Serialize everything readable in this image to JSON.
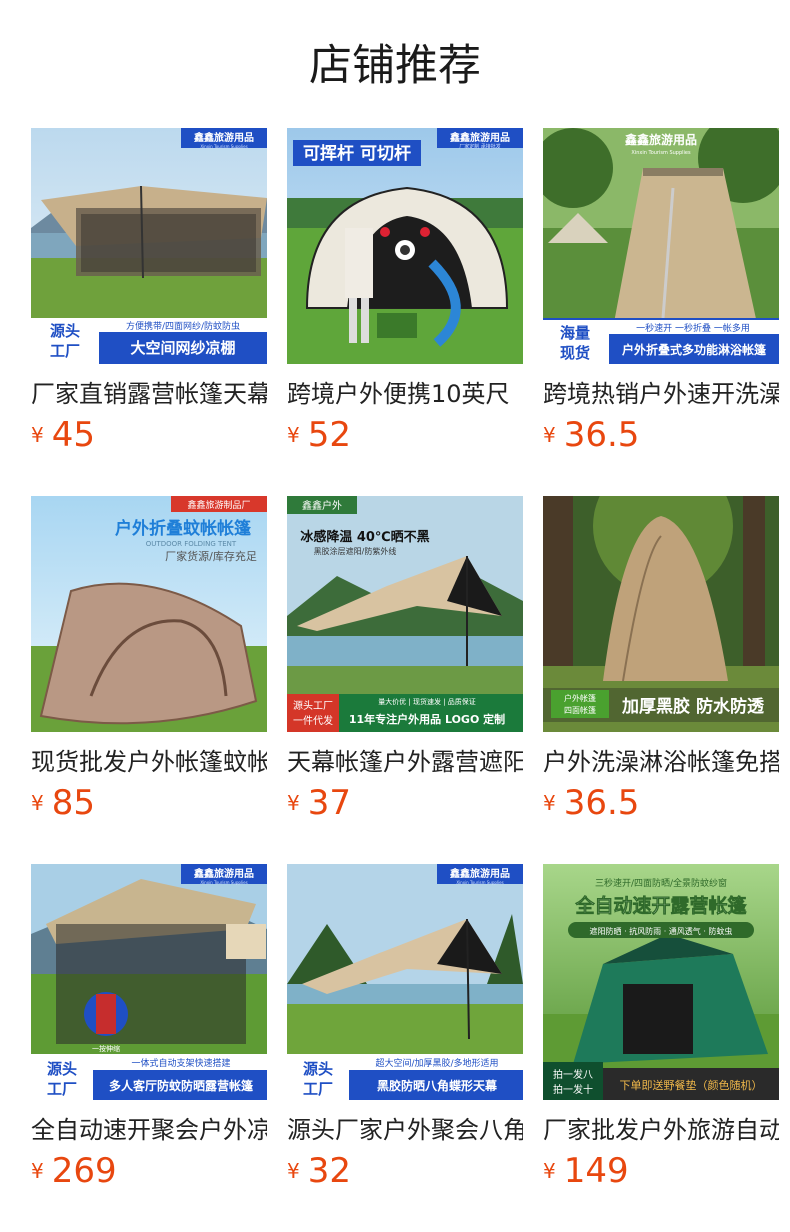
{
  "page": {
    "title": "店铺推荐"
  },
  "products": [
    {
      "name": "厂家直销露营帐篷天幕",
      "currency": "¥",
      "price": "45",
      "overlay": {
        "brand": "鑫鑫旅游用品",
        "brand_en": "Xinxin Tourism Supplies",
        "badge": "源头\n工厂",
        "tagline": "方便携带/四面网纱/防蚊防虫",
        "banner": "大空间网纱凉棚"
      }
    },
    {
      "name": "跨境户外便携10英尺",
      "currency": "¥",
      "price": "52",
      "overlay": {
        "headline": "可挥杆 可切杆",
        "brand": "鑫鑫旅游用品",
        "brand_en": "厂家定制 承接批发"
      }
    },
    {
      "name": "跨境热销户外速开洗澡帐篷",
      "currency": "¥",
      "price": "36.5",
      "overlay": {
        "brand": "鑫鑫旅游用品",
        "brand_en": "Xinxin Tourism Supplies",
        "badge": "海量\n现货",
        "tagline": "一秒速开 一秒折叠 一帐多用",
        "banner": "户外折叠式多功能淋浴帐篷"
      }
    },
    {
      "name": "现货批发户外帐篷蚊帐",
      "currency": "¥",
      "price": "85",
      "overlay": {
        "brand": "鑫鑫旅游制品厂",
        "headline": "户外折叠蚊帐帐篷",
        "sub_en": "OUTDOOR FOLDING TENT",
        "sub": "厂家货源/库存充足"
      }
    },
    {
      "name": "天幕帐篷户外露营遮阳",
      "currency": "¥",
      "price": "37",
      "overlay": {
        "brand": "鑫鑫户外",
        "headline": "冰感降温 40℃晒不黑",
        "sub": "黑胶涂层遮阳/防紫外线",
        "badge": "源头工厂\n一件代发",
        "tagline": "量大价优 | 现货速发 | 品质保证",
        "banner": "11年专注户外用品 LOGO 定制"
      }
    },
    {
      "name": "户外洗澡淋浴帐篷免搭建",
      "currency": "¥",
      "price": "36.5",
      "overlay": {
        "badge": "户外帐篷\n四面帐篷",
        "banner": "加厚黑胶 防水防透"
      }
    },
    {
      "name": "全自动速开聚会户外凉棚",
      "currency": "¥",
      "price": "269",
      "overlay": {
        "brand": "鑫鑫旅游用品",
        "brand_en": "Xinxin Tourism Supplies",
        "badge": "源头\n工厂",
        "tagline": "一体式自动支架快速搭建",
        "banner": "多人客厅防蚊防晒露营帐篷",
        "callout": "一按伸缩"
      }
    },
    {
      "name": "源头厂家户外聚会八角天幕",
      "currency": "¥",
      "price": "32",
      "overlay": {
        "brand": "鑫鑫旅游用品",
        "brand_en": "Xinxin Tourism Supplies",
        "badge": "源头\n工厂",
        "tagline": "超大空间/加厚黑胶/多地形适用",
        "banner": "黑胶防晒八角蝶形天幕"
      }
    },
    {
      "name": "厂家批发户外旅游自动帐篷",
      "currency": "¥",
      "price": "149",
      "overlay": {
        "sub": "三秒速开/四面防晒/全景防蚊纱窗",
        "headline": "全自动速开露营帐篷",
        "tagline": "遮阳防晒 · 抗风防雨 · 通风透气 · 防蚊虫",
        "badge": "拍一发八\n拍一发十",
        "banner": "下单即送野餐垫（颜色随机）"
      }
    }
  ],
  "colors": {
    "price": "#e8470f",
    "title": "#1a1a1a",
    "brand_blue": "#1f4fc4"
  }
}
